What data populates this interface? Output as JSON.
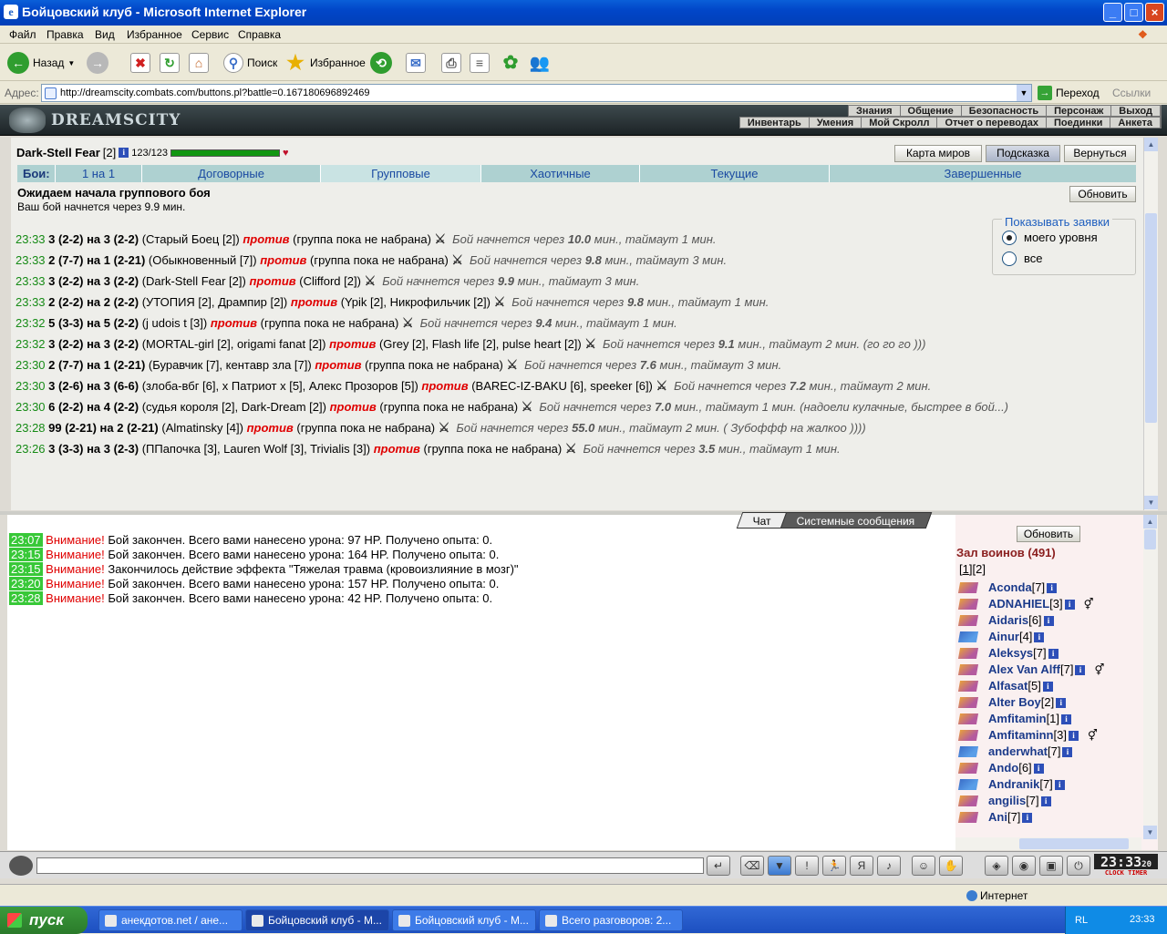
{
  "window": {
    "title": "Бойцовский клуб - Microsoft Internet Explorer",
    "minimize": "_",
    "maximize": "□",
    "close": "×"
  },
  "menu": [
    "Файл",
    "Правка",
    "Вид",
    "Избранное",
    "Сервис",
    "Справка"
  ],
  "toolbar": {
    "back": "Назад",
    "search": "Поиск",
    "favorites": "Избранное"
  },
  "address": {
    "label": "Адрес:",
    "url": "http://dreamscity.combats.com/buttons.pl?battle=0.167180696892469",
    "go": "Переход",
    "links": "Ссылки"
  },
  "site": {
    "logo": "DREAMSCITY",
    "nav_top": [
      "Знания",
      "Общение",
      "Безопасность",
      "Персонаж",
      "Выход"
    ],
    "nav_bottom": [
      "Инвентарь",
      "Умения",
      "Мой Скролл",
      "Отчет о переводах",
      "Поединки",
      "Анкета"
    ]
  },
  "character": {
    "name": "Dark-Stell Fear",
    "level": "[2]",
    "hp": "123/123",
    "hp_fraction": 1.0
  },
  "top_buttons": {
    "world_map": "Карта миров",
    "hint": "Подсказка",
    "back": "Вернуться"
  },
  "tabs": {
    "label": "Бои:",
    "items": [
      "1 на 1",
      "Договорные",
      "Групповые",
      "Хаотичные",
      "Текущие",
      "Завершенные"
    ]
  },
  "status": {
    "title": "Ожидаем начала группового боя",
    "subtitle": "Ваш бой начнется через 9.9 мин.",
    "refresh": "Обновить"
  },
  "filter": {
    "legend": "Показывать заявки",
    "my_level": "моего уровня",
    "all": "все"
  },
  "labels": {
    "vs": "против",
    "not_gathered": "(группа пока не набрана)",
    "starts_in": "Бой начнется через",
    "min_timeout": "мин., таймаут",
    "min": "мин."
  },
  "bids": [
    {
      "time": "23:33",
      "head": "3 (2-2) на 3 (2-2)",
      "side1": "(Старый Боец [2])",
      "side2": "(группа пока не набрана)",
      "starts": "10.0",
      "timeout": "1",
      "note": ""
    },
    {
      "time": "23:33",
      "head": "2 (7-7) на 1 (2-21)",
      "side1": "(Обыкновенный [7])",
      "side2": "(группа пока не набрана)",
      "starts": "9.8",
      "timeout": "3",
      "note": ""
    },
    {
      "time": "23:33",
      "head": "3 (2-2) на 3 (2-2)",
      "side1": "(Dark-Stell Fear [2])",
      "side2": "(Clifford [2])",
      "starts": "9.9",
      "timeout": "3",
      "note": ""
    },
    {
      "time": "23:33",
      "head": "2 (2-2) на 2 (2-2)",
      "side1": "(УТОПИЯ [2], Дрампир [2])",
      "side2": "(Ypik [2], Никрофильчик [2])",
      "starts": "9.8",
      "timeout": "1",
      "note": ""
    },
    {
      "time": "23:32",
      "head": "5 (3-3) на 5 (2-2)",
      "side1": "(j udois t [3])",
      "side2": "(группа пока не набрана)",
      "starts": "9.4",
      "timeout": "1",
      "note": ""
    },
    {
      "time": "23:32",
      "head": "3 (2-2) на 3 (2-2)",
      "side1": "(MORTAL-girl [2], origami fanat [2])",
      "side2": "(Grey [2], Flash life [2], pulse heart [2])",
      "starts": "9.1",
      "timeout": "2",
      "note": "(го го го )))"
    },
    {
      "time": "23:30",
      "head": "2 (7-7) на 1 (2-21)",
      "side1": "(Буравчик [7], кентавр зла [7])",
      "side2": "(группа пока не набрана)",
      "starts": "7.6",
      "timeout": "3",
      "note": ""
    },
    {
      "time": "23:30",
      "head": "3 (2-6) на 3 (6-6)",
      "side1": "(злоба-вбг [6], x Патриот x [5], Алекс Прозоров [5])",
      "side2": "(BAREC-IZ-BAKU [6], speeker [6])",
      "starts": "7.2",
      "timeout": "2",
      "note": ""
    },
    {
      "time": "23:30",
      "head": "6 (2-2) на 4 (2-2)",
      "side1": "(судья короля [2], Dark-Dream [2])",
      "side2": "(группа пока не набрана)",
      "starts": "7.0",
      "timeout": "1",
      "note": "(надоели кулачные, быстрее в бой...)"
    },
    {
      "time": "23:28",
      "head": "99 (2-21) на 2 (2-21)",
      "side1": "(Almatinsky [4])",
      "side2": "(группа пока не набрана)",
      "starts": "55.0",
      "timeout": "2",
      "note": "( Зубоффф на жалкоо ))))"
    },
    {
      "time": "23:26",
      "head": "3 (3-3) на 3 (2-3)",
      "side1": "(ППапочка [3], Lauren Wolf [3], Trivialis [3])",
      "side2": "(группа пока не набрана)",
      "starts": "3.5",
      "timeout": "1",
      "note": ""
    }
  ],
  "chat": {
    "tab_chat": "Чат",
    "tab_system": "Системные сообщения",
    "messages": [
      {
        "time": "23:07",
        "warn": "Внимание!",
        "text": "Бой закончен. Всего вами нанесено урона: 97 HP. Получено опыта: 0."
      },
      {
        "time": "23:15",
        "warn": "Внимание!",
        "text": "Бой закончен. Всего вами нанесено урона: 164 HP. Получено опыта: 0."
      },
      {
        "time": "23:15",
        "warn": "Внимание!",
        "text": "Закончилось действие эффекта \"Тяжелая травма (кровоизлияние в мозг)\""
      },
      {
        "time": "23:20",
        "warn": "Внимание!",
        "text": "Бой закончен. Всего вами нанесено урона: 157 HP. Получено опыта: 0."
      },
      {
        "time": "23:28",
        "warn": "Внимание!",
        "text": "Бой закончен. Всего вами нанесено урона: 42 HP. Получено опыта: 0."
      }
    ]
  },
  "roster": {
    "refresh": "Обновить",
    "title": "Зал воинов (491)",
    "pages": [
      "1",
      "2"
    ],
    "players": [
      {
        "name": "Aconda",
        "level": "[7]"
      },
      {
        "name": "ADNAHIEL",
        "level": "[3]"
      },
      {
        "name": "Aidaris",
        "level": "[6]"
      },
      {
        "name": "Ainur",
        "level": "[4]"
      },
      {
        "name": "Aleksys",
        "level": "[7]"
      },
      {
        "name": "Alex Van Alff",
        "level": "[7]"
      },
      {
        "name": "Alfasat",
        "level": "[5]"
      },
      {
        "name": "Alter Boy",
        "level": "[2]"
      },
      {
        "name": "Amfitamin",
        "level": "[1]"
      },
      {
        "name": "Amfitaminn",
        "level": "[3]"
      },
      {
        "name": "anderwhat",
        "level": "[7]"
      },
      {
        "name": "Ando",
        "level": "[6]"
      },
      {
        "name": "Andranik",
        "level": "[7]"
      },
      {
        "name": "angilis",
        "level": "[7]"
      },
      {
        "name": "Ani",
        "level": "[7]"
      }
    ]
  },
  "clock": {
    "time": "23:33",
    "sec": "20",
    "label": "CLOCK TIMER"
  },
  "statusbar": {
    "zone": "Интернет"
  },
  "taskbar": {
    "start": "пуск",
    "tasks": [
      "анекдотов.net / ане...",
      "Бойцовский клуб - M...",
      "Бойцовский клуб - M...",
      "Всего разговоров: 2..."
    ],
    "lang": "RL",
    "time": "23:33"
  }
}
